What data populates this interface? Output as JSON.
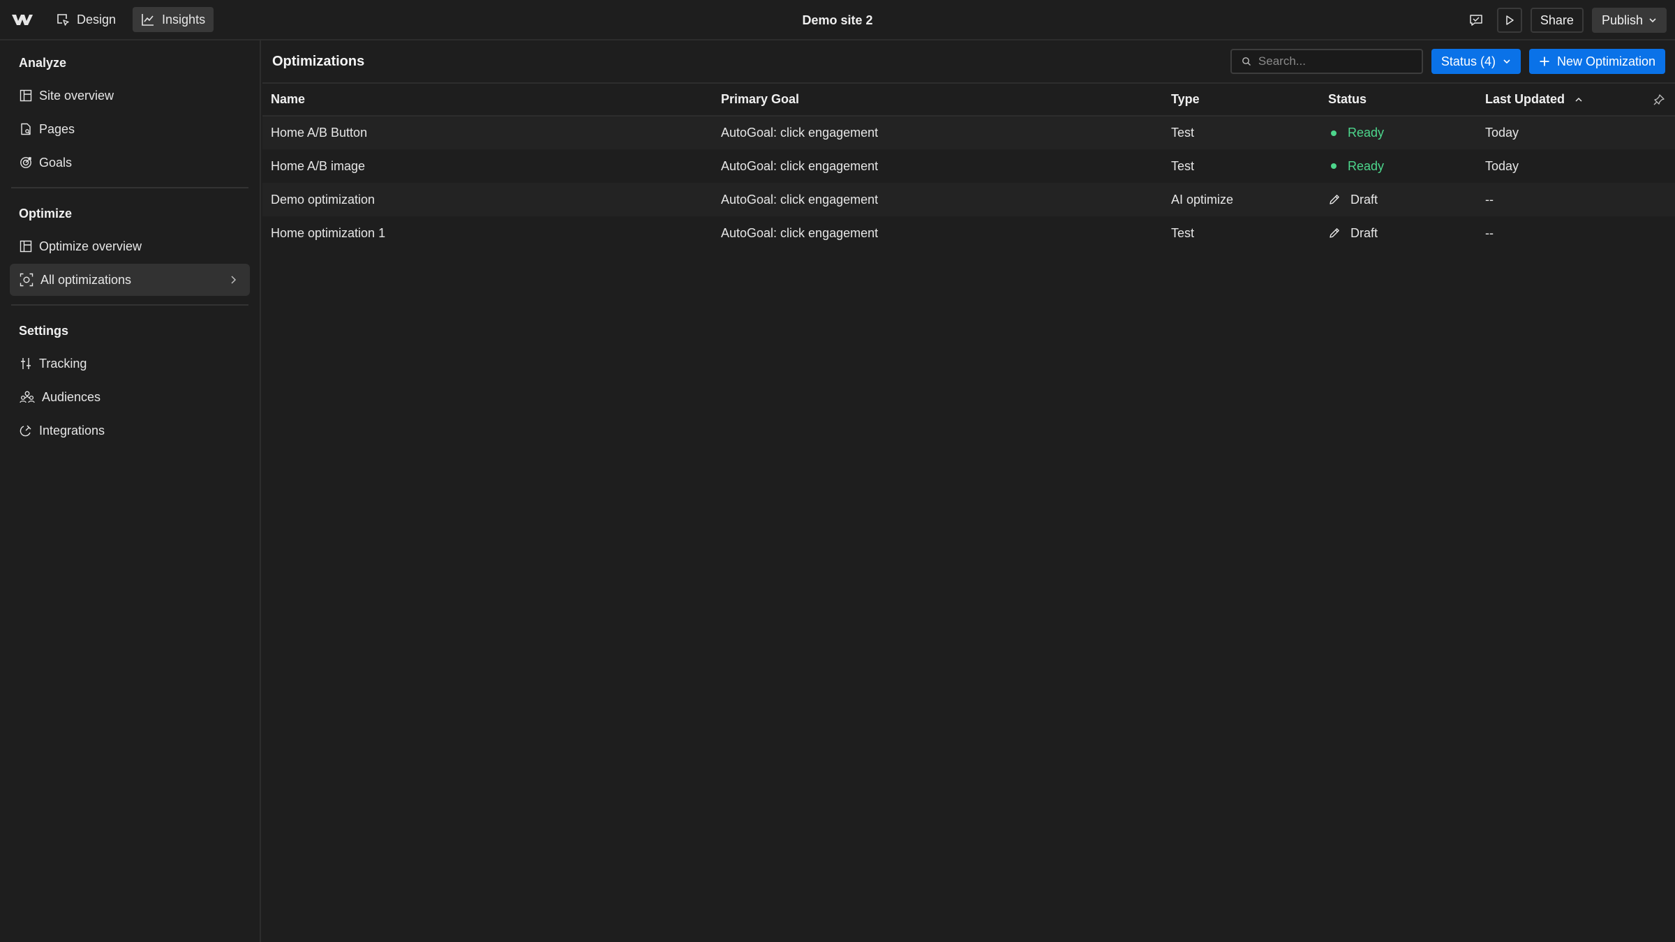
{
  "topbar": {
    "site_title": "Demo site 2",
    "modes": [
      {
        "label": "Design",
        "icon": "cursor-square-icon",
        "active": false
      },
      {
        "label": "Insights",
        "icon": "line-chart-icon",
        "active": true
      }
    ],
    "share_label": "Share",
    "publish_label": "Publish"
  },
  "sidebar": {
    "sections": [
      {
        "title": "Analyze",
        "items": [
          {
            "label": "Site overview",
            "icon": "layout-icon"
          },
          {
            "label": "Pages",
            "icon": "page-icon"
          },
          {
            "label": "Goals",
            "icon": "target-icon"
          }
        ]
      },
      {
        "title": "Optimize",
        "items": [
          {
            "label": "Optimize overview",
            "icon": "layout-icon"
          },
          {
            "label": "All optimizations",
            "icon": "focus-icon",
            "active": true
          }
        ]
      },
      {
        "title": "Settings",
        "items": [
          {
            "label": "Tracking",
            "icon": "sliders-icon"
          },
          {
            "label": "Audiences",
            "icon": "people-icon"
          },
          {
            "label": "Integrations",
            "icon": "plug-icon"
          }
        ]
      }
    ]
  },
  "main": {
    "title": "Optimizations",
    "search_placeholder": "Search...",
    "status_filter_label": "Status (4)",
    "new_button_label": "New Optimization",
    "columns": {
      "name": "Name",
      "goal": "Primary Goal",
      "type": "Type",
      "status": "Status",
      "updated": "Last Updated"
    },
    "rows": [
      {
        "name": "Home A/B Button",
        "goal": "AutoGoal: click engagement",
        "type": "Test",
        "status": "Ready",
        "updated": "Today"
      },
      {
        "name": "Home A/B image",
        "goal": "AutoGoal: click engagement",
        "type": "Test",
        "status": "Ready",
        "updated": "Today"
      },
      {
        "name": "Demo optimization",
        "goal": "AutoGoal: click engagement",
        "type": "AI optimize",
        "status": "Draft",
        "updated": "--"
      },
      {
        "name": "Home optimization 1",
        "goal": "AutoGoal: click engagement",
        "type": "Test",
        "status": "Draft",
        "updated": "--"
      }
    ]
  },
  "colors": {
    "accent": "#0a72e8",
    "ready": "#4dd68c",
    "background": "#1e1e1e"
  }
}
